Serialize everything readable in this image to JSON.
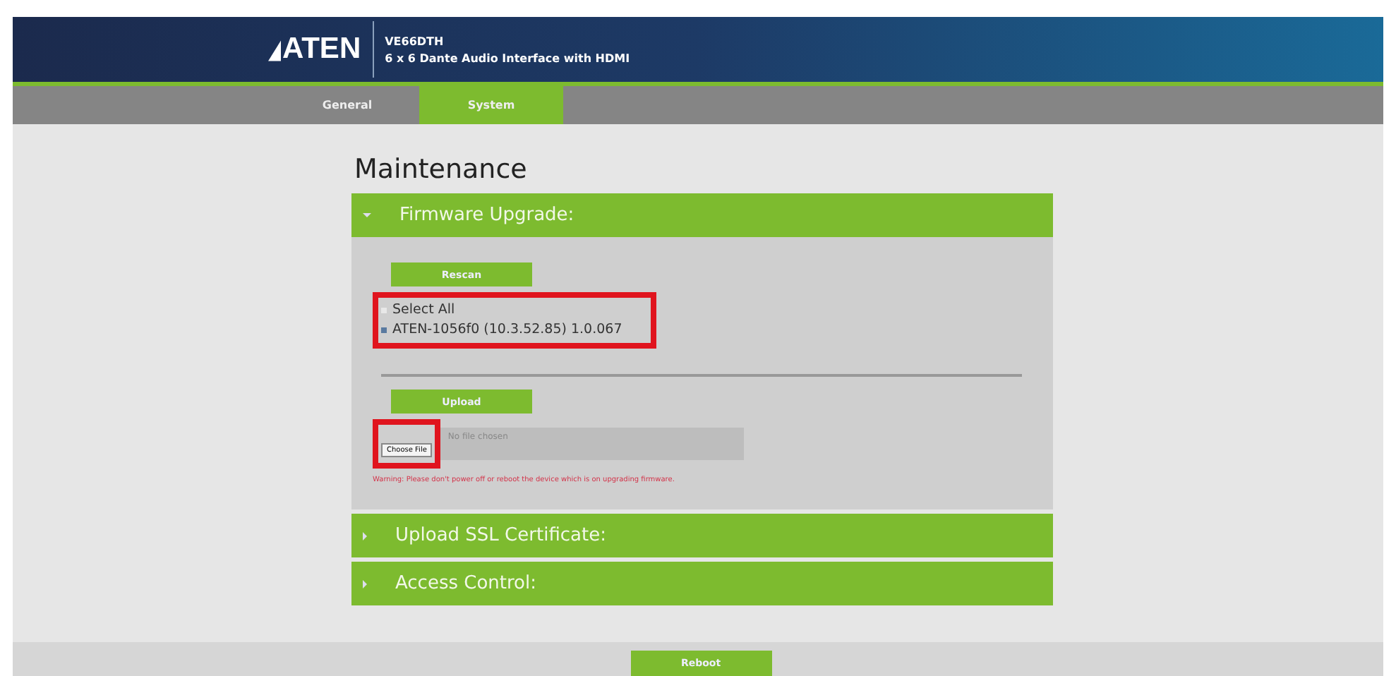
{
  "header": {
    "brand": "ATEN",
    "model": "VE66DTH",
    "product": "6 x 6 Dante Audio Interface with HDMI"
  },
  "tabs": [
    {
      "label": "General",
      "selected": false
    },
    {
      "label": "System",
      "selected": true
    }
  ],
  "page_title": "Maintenance",
  "sections": [
    {
      "title": "Firmware Upgrade:",
      "expanded": true
    },
    {
      "title": "Upload SSL Certificate:",
      "expanded": false
    },
    {
      "title": "Access Control:",
      "expanded": false
    }
  ],
  "firmware": {
    "rescan_button": "Rescan",
    "devices": [
      {
        "label": "Select All",
        "checked": false
      },
      {
        "label": "ATEN-1056f0 (10.3.52.85) 1.0.067",
        "checked": true
      }
    ],
    "upload_button": "Upload",
    "choose_file_button": "Choose File",
    "file_placeholder": "No file chosen",
    "warning": "Warning: Please don't power off or reboot the device which is on upgrading firmware."
  },
  "reboot_button": "Reboot"
}
